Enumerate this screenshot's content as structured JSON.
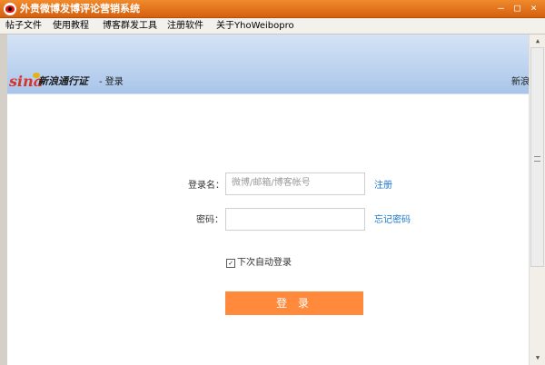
{
  "window": {
    "title": "外贵微博发博评论营销系统",
    "controls": {
      "minimize": "—",
      "maximize": "□",
      "close": "×"
    }
  },
  "menu": {
    "items": [
      {
        "label": "帖子文件"
      },
      {
        "label": "使用教程"
      },
      {
        "label": "博客群发工具"
      },
      {
        "label": "注册软件"
      },
      {
        "label": "关于YhoWeibopro"
      }
    ]
  },
  "page_header": {
    "logo_text": "sina",
    "passport_text": "新浪通行证",
    "crumb": "- 登录",
    "right_text": "新浪"
  },
  "login_form": {
    "username_label": "登录名：",
    "username_placeholder": "微博/邮箱/博客帐号",
    "register_link": "注册",
    "password_label": "密码：",
    "password_value": "",
    "forgot_link": "忘记密码",
    "auto_login_label": "下次自动登录",
    "auto_login_checked": "✓",
    "submit_label": "登 录"
  },
  "scrollbar": {
    "up_arrow": "▲",
    "down_arrow": "▼"
  },
  "colors": {
    "titlebar": "#e8731d",
    "login_button": "#ff8a3c",
    "link": "#1a77c9",
    "header_band": "#b4cdef"
  }
}
